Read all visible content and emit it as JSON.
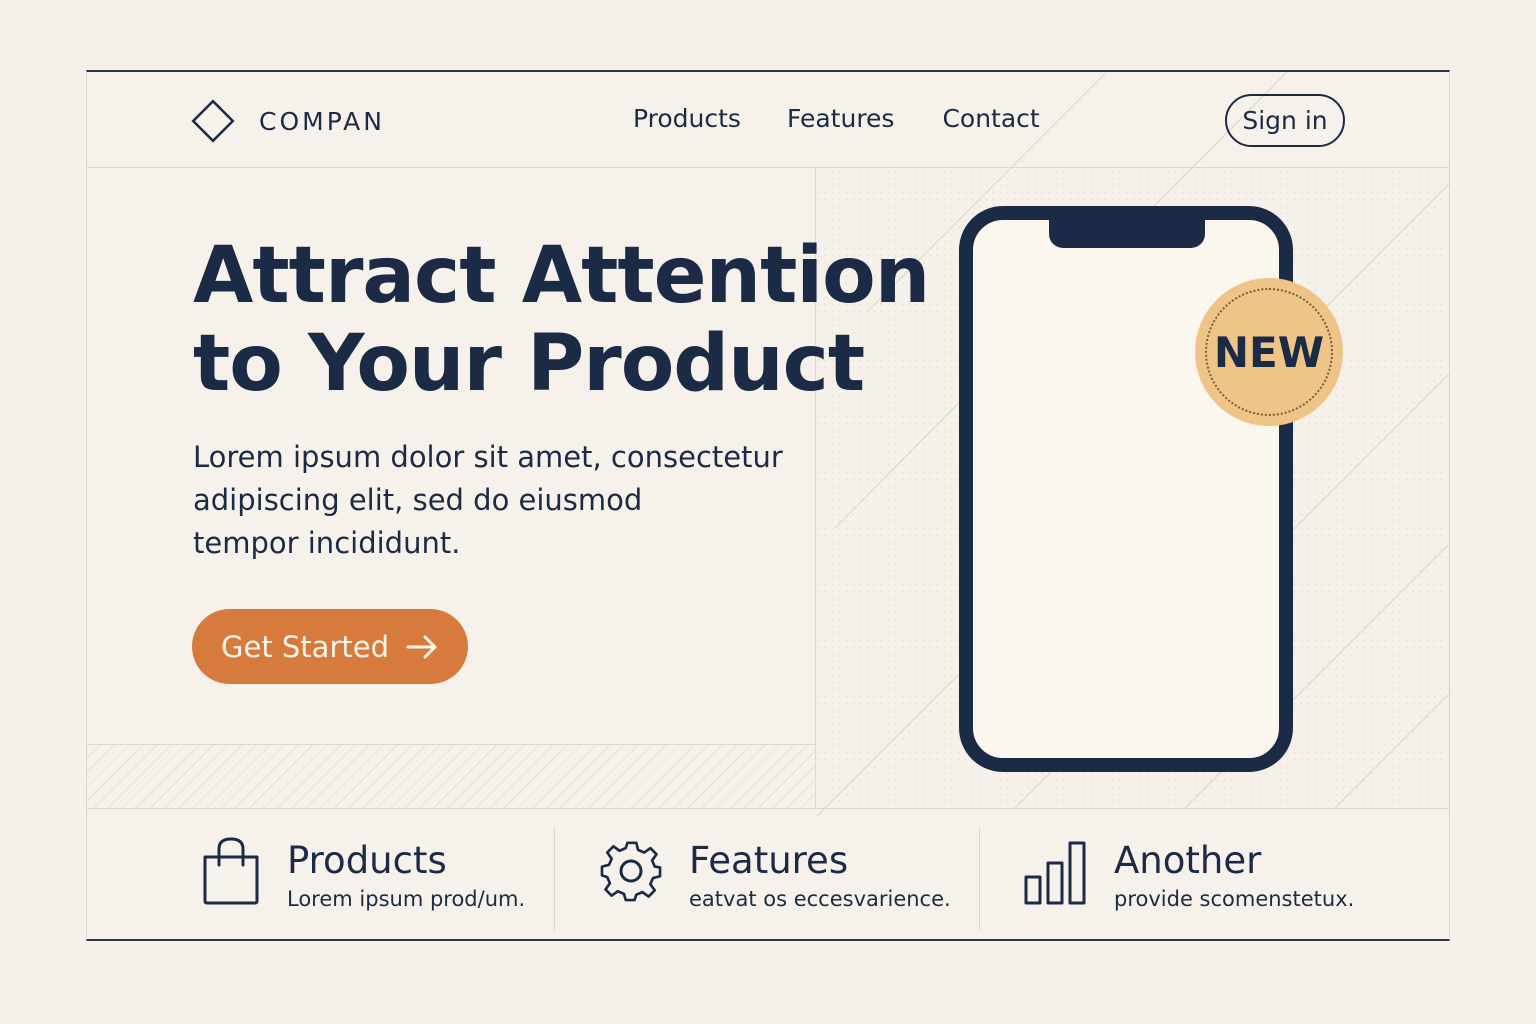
{
  "brand": {
    "name": "COMPAN",
    "logo_icon": "diamond-icon"
  },
  "nav": {
    "items": [
      "Products",
      "Features",
      "Contact"
    ],
    "signin_label": "Sign in"
  },
  "hero": {
    "headline_lines": [
      "Attract Attention",
      "to Your Product"
    ],
    "subtext_lines": [
      "Lorem ipsum dolor sit amet, consectetur",
      "adipiscing elit, sed do eiusmod",
      "tempor incididunt."
    ],
    "cta_label": "Get Started",
    "cta_icon": "arrow-right-icon",
    "badge_label": "NEW"
  },
  "features": [
    {
      "icon": "shopping-bag-icon",
      "title": "Products",
      "desc": "Lorem ipsum prod/um."
    },
    {
      "icon": "gear-icon",
      "title": "Features",
      "desc": "eatvat os eccesvarience."
    },
    {
      "icon": "bar-chart-icon",
      "title": "Another",
      "desc": "provide scomenstetux."
    }
  ],
  "colors": {
    "background": "#f5f1ea",
    "ink": "#1c2b45",
    "accent": "#d67a3d",
    "badge": "#efc489"
  }
}
